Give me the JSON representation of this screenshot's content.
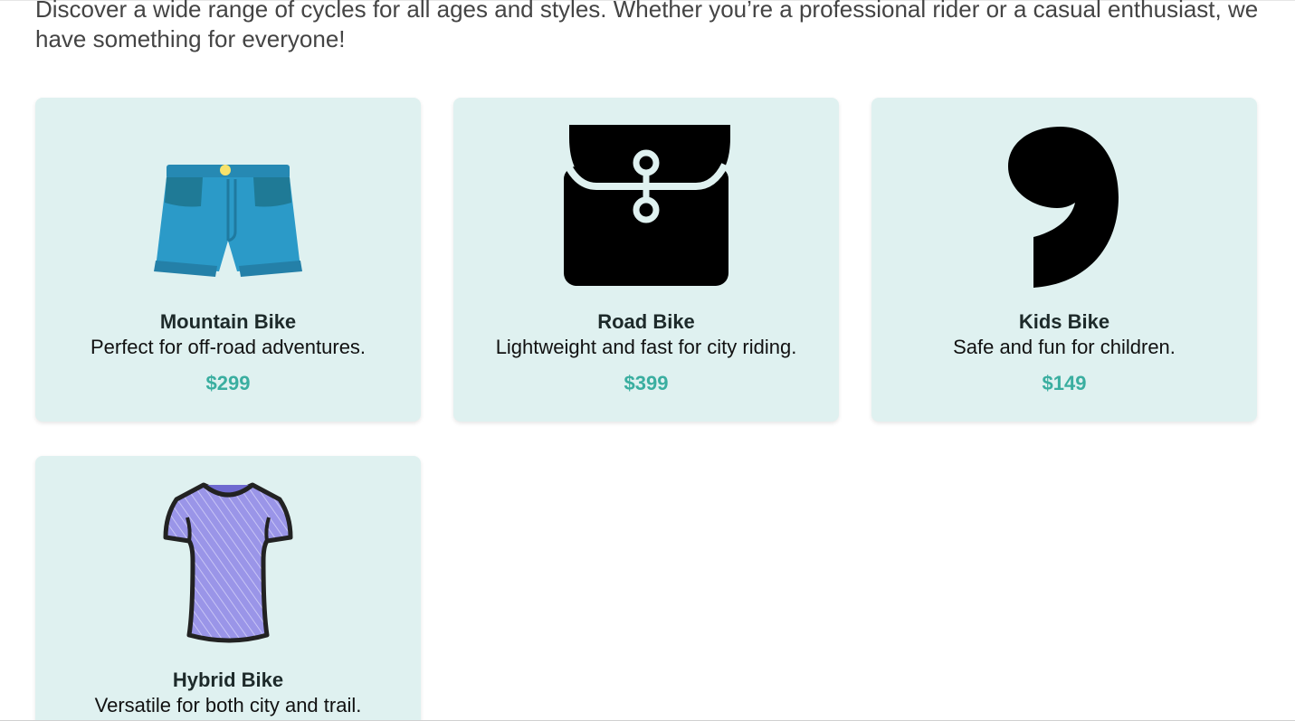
{
  "intro": {
    "text": "Discover a wide range of cycles for all ages and styles. Whether you’re a professional rider or a casual enthusiast, we have something for everyone!"
  },
  "colors": {
    "card_background": "#dff1f0",
    "price": "#3aaea0",
    "shorts": "#2b9ac8",
    "tshirt": "#9a95e8"
  },
  "products": [
    {
      "title": "Mountain Bike",
      "description": "Perfect for off-road adventures.",
      "price": "$299",
      "icon": "shorts-icon"
    },
    {
      "title": "Road Bike",
      "description": "Lightweight and fast for city riding.",
      "price": "$399",
      "icon": "envelope-pouch-icon"
    },
    {
      "title": "Kids Bike",
      "description": "Safe and fun for children.",
      "price": "$149",
      "icon": "comma-icon"
    },
    {
      "title": "Hybrid Bike",
      "description": "Versatile for both city and trail.",
      "price": "",
      "icon": "tshirt-icon"
    }
  ]
}
